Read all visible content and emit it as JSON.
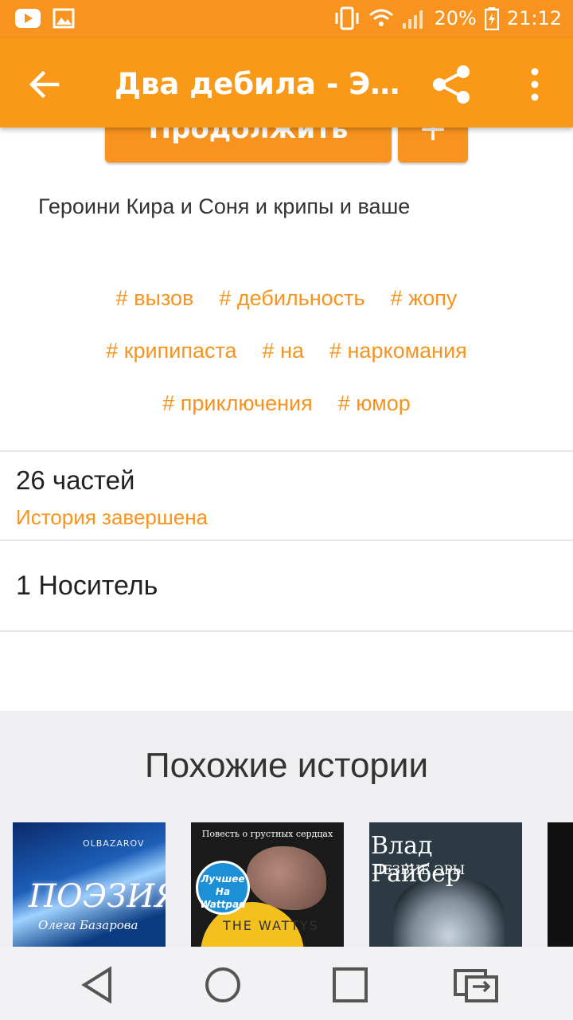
{
  "status_bar": {
    "battery": "20%",
    "time": "21:12"
  },
  "app_bar": {
    "title": "Два дебила - Это..."
  },
  "actions": {
    "continue_label": "Продолжить",
    "add_label": "+"
  },
  "story": {
    "description": "Героини Кира и Соня и крипы и ваше",
    "tags": [
      [
        "# вызов",
        "# дебильность",
        "# жопу"
      ],
      [
        "# крипипаста",
        "# на",
        "# наркомания"
      ],
      [
        "# приключения",
        "# юмор"
      ]
    ],
    "parts_count": "26 частей",
    "status": "История завершена",
    "carrier": "1 Носитель"
  },
  "similar": {
    "title": "Похожие истории",
    "covers": [
      {
        "author": "OLBAZAROV",
        "title": "ПОЭЗИЯ",
        "subtitle": "Олега Базарова"
      },
      {
        "top": "Повесть о грустных сердцах",
        "badge": "Лучшее На Wattpad",
        "brand": "THE WATTYS"
      },
      {
        "title": "Влад Райбер",
        "subtitle": "ЛЕЗВИЕ ЭРЫ"
      }
    ]
  },
  "colors": {
    "accent": "#f7931e",
    "app_bar": "#fa9918"
  }
}
